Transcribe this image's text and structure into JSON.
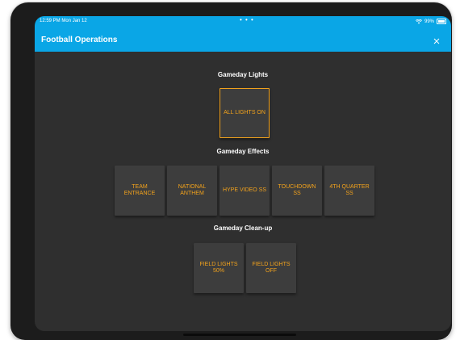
{
  "status": {
    "time_date": "12:59 PM  Mon Jan 12",
    "dots": "• • •",
    "battery_text": "99%"
  },
  "header": {
    "title": "Football Operations",
    "close_label": "×"
  },
  "sections": [
    {
      "title": "Gameday Lights",
      "buttons": [
        "ALL LIGHTS ON"
      ]
    },
    {
      "title": "Gameday Effects",
      "buttons": [
        "TEAM ENTRANCE",
        "NATIONAL ANTHEM",
        "HYPE VIDEO SS",
        "TOUCHDOWN SS",
        "4TH QUARTER SS"
      ]
    },
    {
      "title": "Gameday Clean-up",
      "buttons": [
        "FIELD LIGHTS 50%",
        "FIELD LIGHTS OFF"
      ]
    }
  ],
  "colors": {
    "accent": "#0aa6e6",
    "button_text": "#f2a21c",
    "background": "#2f2f2f",
    "button_bg": "#3d3d3d"
  },
  "icons": {
    "close": "close-icon",
    "wifi": "wifi-icon",
    "battery": "battery-icon"
  }
}
